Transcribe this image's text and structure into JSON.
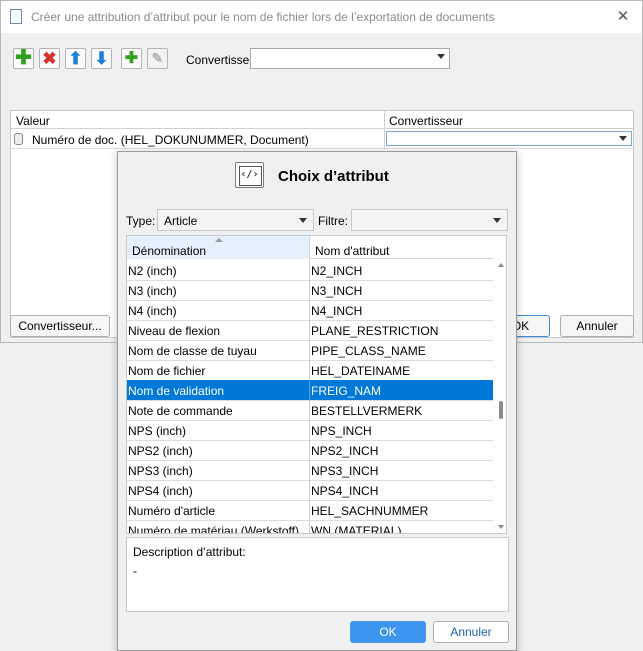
{
  "outer": {
    "title": "Créer une attribution d’attribut pour le nom de fichier lors de l’exportation de documents",
    "close_glyph": "✕",
    "toolbar": {
      "add_icon": "plus-icon",
      "delete_icon": "delete-x-icon",
      "up_icon": "arrow-up-icon",
      "down_icon": "arrow-down-icon",
      "add_sub_icon": "add-child-icon",
      "edit_icon": "edit-pencil-icon",
      "converter_label": "Convertisse",
      "converter_value": ""
    },
    "grid": {
      "columns": [
        "Valeur",
        "Convertisseur"
      ],
      "rows": [
        {
          "value": "Numéro de doc. (HEL_DOKUNUMMER, Document)",
          "converter": ""
        }
      ]
    },
    "converter_button": "Convertisseur...",
    "ok_button": "OK",
    "cancel_button": "Annuler"
  },
  "modal": {
    "title": "Choix d’attribut",
    "icon": "code-tag-icon",
    "icon_text": "‹/›",
    "type_label": "Type:",
    "type_value": "Article",
    "filter_label": "Filtre:",
    "filter_value": "",
    "columns": [
      "Dénomination",
      "Nom d'attribut"
    ],
    "rows": [
      {
        "name": "N2 (inch)",
        "attr": "N2_INCH"
      },
      {
        "name": "N3 (inch)",
        "attr": "N3_INCH"
      },
      {
        "name": "N4 (inch)",
        "attr": "N4_INCH"
      },
      {
        "name": "Niveau de flexion",
        "attr": "PLANE_RESTRICTION"
      },
      {
        "name": "Nom de classe de tuyau",
        "attr": "PIPE_CLASS_NAME"
      },
      {
        "name": "Nom de fichier",
        "attr": "HEL_DATEINAME"
      },
      {
        "name": "Nom de validation",
        "attr": "FREIG_NAM",
        "selected": true
      },
      {
        "name": "Note de commande",
        "attr": "BESTELLVERMERK"
      },
      {
        "name": "NPS (inch)",
        "attr": "NPS_INCH"
      },
      {
        "name": "NPS2 (inch)",
        "attr": "NPS2_INCH"
      },
      {
        "name": "NPS3 (inch)",
        "attr": "NPS3_INCH"
      },
      {
        "name": "NPS4 (inch)",
        "attr": "NPS4_INCH"
      },
      {
        "name": "Numéro d'article",
        "attr": "HEL_SACHNUMMER"
      },
      {
        "name": "Numéro de matériau (Werkstoff)",
        "attr": "WN (MATERIAL)"
      }
    ],
    "description_label": "Description d’attribut:",
    "description_value": "-",
    "ok_button": "OK",
    "cancel_button": "Annuler"
  }
}
